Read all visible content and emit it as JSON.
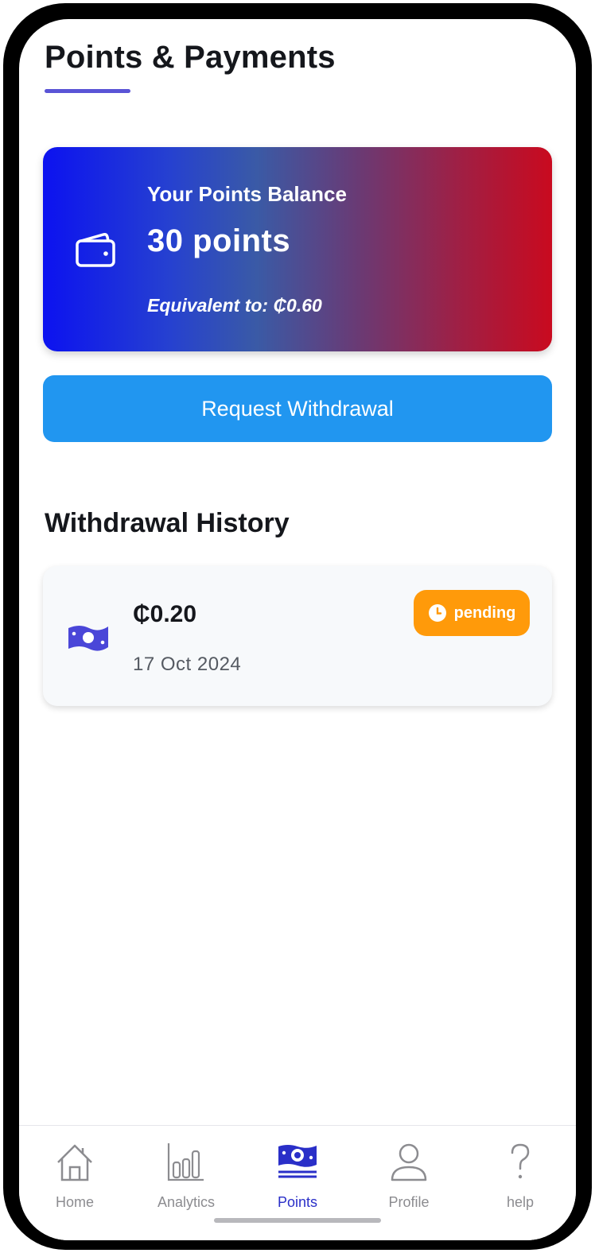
{
  "page": {
    "title": "Points & Payments"
  },
  "balance": {
    "label": "Your Points Balance",
    "value": "30 points",
    "equivalent": "Equivalent to: ₵0.60",
    "icon": "wallet-icon"
  },
  "actions": {
    "withdraw_label": "Request Withdrawal"
  },
  "history": {
    "heading": "Withdrawal History",
    "items": [
      {
        "amount": "₵0.20",
        "date": "17 Oct 2024",
        "status": "pending",
        "status_icon": "clock-icon",
        "icon": "money-icon"
      }
    ]
  },
  "nav": {
    "items": [
      {
        "label": "Home",
        "icon": "home-icon",
        "active": false
      },
      {
        "label": "Analytics",
        "icon": "analytics-icon",
        "active": false
      },
      {
        "label": "Points",
        "icon": "points-icon",
        "active": true
      },
      {
        "label": "Profile",
        "icon": "profile-icon",
        "active": false
      },
      {
        "label": "help",
        "icon": "help-icon",
        "active": false
      }
    ]
  },
  "colors": {
    "accent": "#5a54d6",
    "button": "#2196f0",
    "pending": "#ff9a0a",
    "nav_active": "#2a2fc8",
    "gradient_start": "#0c12f0",
    "gradient_end": "#c90a1f"
  }
}
